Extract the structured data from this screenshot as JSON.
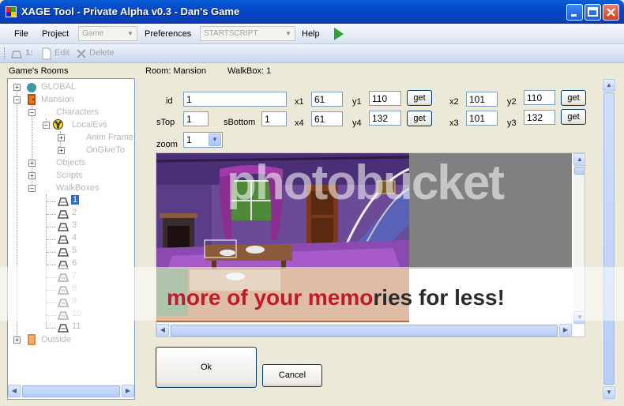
{
  "window": {
    "title": "XAGE Tool - Private Alpha v0.3 - Dan's Game"
  },
  "menu": {
    "file": "File",
    "project": "Project",
    "game_combo": "Game",
    "preferences": "Preferences",
    "script_combo": "STARTSCRIPT",
    "help": "Help"
  },
  "toolbar": {
    "item_count": "1:",
    "edit": "Edit",
    "delete": "Delete"
  },
  "left_panel": {
    "title": "Game's Rooms",
    "tree": {
      "global": "GLOBAL",
      "mansion": "Mansion",
      "characters": "Characters",
      "local_evs": "LocalEvs",
      "anim_frames": "Anim Frames",
      "on_give_to": "OnGiveTo",
      "objects": "Objects",
      "scripts": "Scripts",
      "walkboxes": "WalkBoxes",
      "walkbox_items": [
        "1",
        "2",
        "3",
        "4",
        "5",
        "6",
        "7",
        "8",
        "9",
        "10",
        "11"
      ],
      "outside": "Outside"
    }
  },
  "header": {
    "room_label": "Room: Mansion",
    "walkbox_label": "WalkBox: 1"
  },
  "form": {
    "id_label": "id",
    "id_value": "1",
    "stop_label": "sTop",
    "stop_value": "1",
    "sbottom_label": "sBottom",
    "sbottom_value": "1",
    "zoom_label": "zoom",
    "zoom_value": "1",
    "x1_label": "x1",
    "x1_value": "61",
    "y1_label": "y1",
    "y1_value": "110",
    "x2_label": "x2",
    "x2_value": "101",
    "y2_label": "y2",
    "y2_value": "110",
    "x3_label": "x3",
    "x3_value": "101",
    "y3_label": "y3",
    "y3_value": "132",
    "x4_label": "x4",
    "x4_value": "61",
    "y4_label": "y4",
    "y4_value": "132",
    "get_label": "get"
  },
  "buttons": {
    "ok": "Ok",
    "cancel": "Cancel"
  },
  "watermark": {
    "top": "photobucket",
    "bottom_red1": "more of your memo",
    "bottom_dark": "ries for less!"
  }
}
